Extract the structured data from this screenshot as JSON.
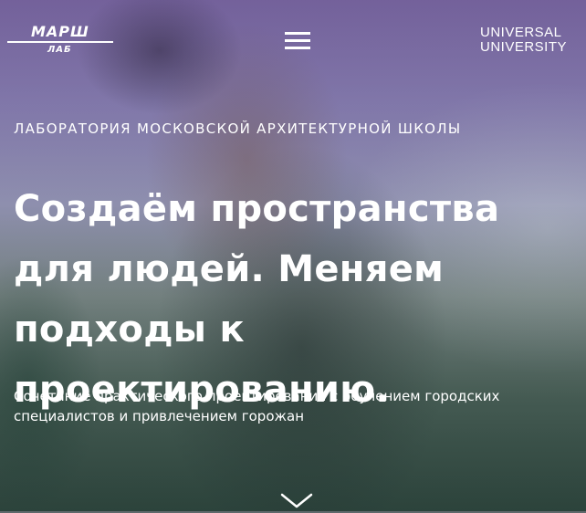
{
  "header": {
    "logo": {
      "top": "МАРШ",
      "bottom": "ЛАБ"
    },
    "menu_icon": "hamburger-menu-icon",
    "partner": {
      "line1": "UNIVERSAL",
      "line2": "UNIVERSITY"
    }
  },
  "hero": {
    "eyebrow": "ЛАБОРАТОРИЯ МОСКОВСКОЙ АРХИТЕКТУРНОЙ ШКОЛЫ",
    "headline": "Создаём пространства для людей. Меняем подходы к проектированию.",
    "lead": "Сочетание практического проектирования с обучением городских специалистов и привлечением горожан",
    "scroll_icon": "chevron-down-icon"
  },
  "colors": {
    "text": "#ffffff",
    "overlay_top": "#8674ad",
    "overlay_bottom": "#3e544b"
  }
}
